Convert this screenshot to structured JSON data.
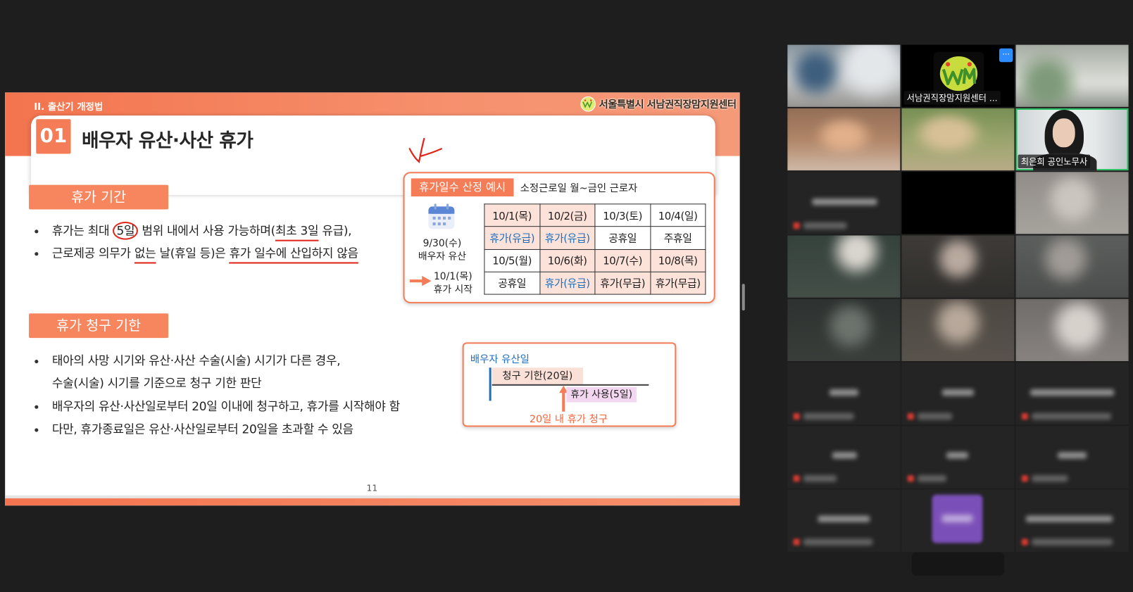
{
  "colors": {
    "background": "#1e1e1e",
    "accent": "#f47c56",
    "annotation": "#e0261b",
    "paid_text": "#1f6fc0",
    "highlight_cell": "#fde2d9",
    "active_speaker_border": "#24c25f",
    "more_button": "#2d8cff"
  },
  "slide": {
    "section_header": "II. 출산기 개정법",
    "logo_text": "서울특별시 서남권직장맘지원센터",
    "number": "01",
    "title": "배우자 유산·사산 휴가",
    "period": {
      "label": "휴가 기간",
      "bullets": [
        {
          "segments": [
            "휴가는 최대 ",
            "5일",
            " 범위 내에서 사용 가능하며(",
            "최초 3일",
            " 유급),"
          ]
        },
        {
          "segments": [
            "근로제공 의무가 ",
            "없는",
            " 날(휴일 등)은 ",
            "휴가 일수에 산입하지 않음"
          ]
        }
      ]
    },
    "example": {
      "label": "휴가일수 산정 예시",
      "condition": "소정근로일 월~금인 근로자",
      "icon": "calendar-icon",
      "event_date": "9/30(수)",
      "event_text": "배우자 유산",
      "start_date": "10/1(목)",
      "start_text": "휴가 시작",
      "table": [
        [
          {
            "text": "10/1(목)",
            "highlight": true
          },
          {
            "text": "10/2(금)",
            "highlight": true
          },
          {
            "text": "10/3(토)"
          },
          {
            "text": "10/4(일)"
          }
        ],
        [
          {
            "text": "휴가(유급)",
            "highlight": true,
            "paid": true
          },
          {
            "text": "휴가(유급)",
            "highlight": true,
            "paid": true
          },
          {
            "text": "공휴일"
          },
          {
            "text": "주휴일"
          }
        ],
        [
          {
            "text": "10/5(월)"
          },
          {
            "text": "10/6(화)",
            "highlight": true
          },
          {
            "text": "10/7(수)",
            "highlight": true
          },
          {
            "text": "10/8(목)",
            "highlight": true
          }
        ],
        [
          {
            "text": "공휴일"
          },
          {
            "text": "휴가(유급)",
            "highlight": true,
            "paid": true
          },
          {
            "text": "휴가(무급)",
            "highlight": true
          },
          {
            "text": "휴가(무급)",
            "highlight": true
          }
        ]
      ]
    },
    "deadline": {
      "label": "휴가 청구 기한",
      "bullets": [
        {
          "lines": [
            "태아의 사망 시기와 유산·사산 수술(시술) 시기가 다른 경우,",
            "수술(시술) 시기를 기준으로 청구 기한 판단"
          ]
        },
        {
          "lines": [
            "배우자의 유산·사산일로부터 20일 이내에 청구하고, 휴가를 시작해야 함"
          ]
        },
        {
          "lines": [
            "다만, 휴가종료일은 유산·사산일로부터 20일을 초과할 수 있음"
          ]
        }
      ],
      "diagram": {
        "title": "배우자 유산일",
        "claim_period": "청구 기한(20일)",
        "leave_use": "휴가 사용(5일)",
        "caption": "20일 내 휴가 청구"
      }
    },
    "page_number": "11"
  },
  "participants": {
    "host_tile_label": "서남권직장맘지원센터 ...",
    "more_button_label": "···",
    "speaker_label": "최은희 공인노무사"
  }
}
